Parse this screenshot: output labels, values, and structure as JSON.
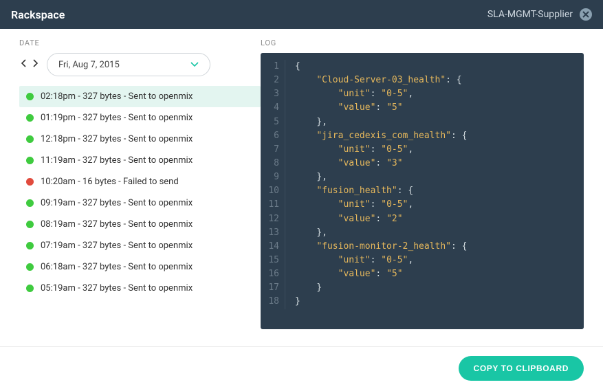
{
  "header": {
    "title": "Rackspace",
    "context": "SLA-MGMT-Supplier"
  },
  "labels": {
    "date": "DATE",
    "log": "LOG"
  },
  "date_nav": {
    "selected_date": "Fri, Aug 7, 2015"
  },
  "log_items": [
    {
      "status": "ok",
      "time": "02:18pm",
      "bytes": "327 bytes",
      "result": "Sent to openmix",
      "selected": true
    },
    {
      "status": "ok",
      "time": "01:19pm",
      "bytes": "327 bytes",
      "result": "Sent to openmix",
      "selected": false
    },
    {
      "status": "ok",
      "time": "12:18pm",
      "bytes": "327 bytes",
      "result": "Sent to openmix",
      "selected": false
    },
    {
      "status": "ok",
      "time": "11:19am",
      "bytes": "327 bytes",
      "result": "Sent to openmix",
      "selected": false
    },
    {
      "status": "fail",
      "time": "10:20am",
      "bytes": "16 bytes",
      "result": "Failed to send",
      "selected": false
    },
    {
      "status": "ok",
      "time": "09:19am",
      "bytes": "327 bytes",
      "result": "Sent to openmix",
      "selected": false
    },
    {
      "status": "ok",
      "time": "08:19am",
      "bytes": "327 bytes",
      "result": "Sent to openmix",
      "selected": false
    },
    {
      "status": "ok",
      "time": "07:19am",
      "bytes": "327 bytes",
      "result": "Sent to openmix",
      "selected": false
    },
    {
      "status": "ok",
      "time": "06:18am",
      "bytes": "327 bytes",
      "result": "Sent to openmix",
      "selected": false
    },
    {
      "status": "ok",
      "time": "05:19am",
      "bytes": "327 bytes",
      "result": "Sent to openmix",
      "selected": false
    }
  ],
  "code_pane": {
    "lines": [
      {
        "n": 1,
        "tokens": [
          [
            "punc",
            "{"
          ]
        ]
      },
      {
        "n": 2,
        "tokens": [
          [
            "indent",
            "    "
          ],
          [
            "key",
            "\"Cloud-Server-03_health\""
          ],
          [
            "punc",
            ": {"
          ]
        ]
      },
      {
        "n": 3,
        "tokens": [
          [
            "indent",
            "        "
          ],
          [
            "key",
            "\"unit\""
          ],
          [
            "punc",
            ": "
          ],
          [
            "str",
            "\"0-5\""
          ],
          [
            "punc",
            ","
          ]
        ]
      },
      {
        "n": 4,
        "tokens": [
          [
            "indent",
            "        "
          ],
          [
            "key",
            "\"value\""
          ],
          [
            "punc",
            ": "
          ],
          [
            "str",
            "\"5\""
          ]
        ]
      },
      {
        "n": 5,
        "tokens": [
          [
            "indent",
            "    "
          ],
          [
            "punc",
            "},"
          ]
        ]
      },
      {
        "n": 6,
        "tokens": [
          [
            "indent",
            "    "
          ],
          [
            "key",
            "\"jira_cedexis_com_health\""
          ],
          [
            "punc",
            ": {"
          ]
        ]
      },
      {
        "n": 7,
        "tokens": [
          [
            "indent",
            "        "
          ],
          [
            "key",
            "\"unit\""
          ],
          [
            "punc",
            ": "
          ],
          [
            "str",
            "\"0-5\""
          ],
          [
            "punc",
            ","
          ]
        ]
      },
      {
        "n": 8,
        "tokens": [
          [
            "indent",
            "        "
          ],
          [
            "key",
            "\"value\""
          ],
          [
            "punc",
            ": "
          ],
          [
            "str",
            "\"3\""
          ]
        ]
      },
      {
        "n": 9,
        "tokens": [
          [
            "indent",
            "    "
          ],
          [
            "punc",
            "},"
          ]
        ]
      },
      {
        "n": 10,
        "tokens": [
          [
            "indent",
            "    "
          ],
          [
            "key",
            "\"fusion_health\""
          ],
          [
            "punc",
            ": {"
          ]
        ]
      },
      {
        "n": 11,
        "tokens": [
          [
            "indent",
            "        "
          ],
          [
            "key",
            "\"unit\""
          ],
          [
            "punc",
            ": "
          ],
          [
            "str",
            "\"0-5\""
          ],
          [
            "punc",
            ","
          ]
        ]
      },
      {
        "n": 12,
        "tokens": [
          [
            "indent",
            "        "
          ],
          [
            "key",
            "\"value\""
          ],
          [
            "punc",
            ": "
          ],
          [
            "str",
            "\"2\""
          ]
        ]
      },
      {
        "n": 13,
        "tokens": [
          [
            "indent",
            "    "
          ],
          [
            "punc",
            "},"
          ]
        ]
      },
      {
        "n": 14,
        "tokens": [
          [
            "indent",
            "    "
          ],
          [
            "key",
            "\"fusion-monitor-2_health\""
          ],
          [
            "punc",
            ": {"
          ]
        ]
      },
      {
        "n": 15,
        "tokens": [
          [
            "indent",
            "        "
          ],
          [
            "key",
            "\"unit\""
          ],
          [
            "punc",
            ": "
          ],
          [
            "str",
            "\"0-5\""
          ],
          [
            "punc",
            ","
          ]
        ]
      },
      {
        "n": 16,
        "tokens": [
          [
            "indent",
            "        "
          ],
          [
            "key",
            "\"value\""
          ],
          [
            "punc",
            ": "
          ],
          [
            "str",
            "\"5\""
          ]
        ]
      },
      {
        "n": 17,
        "tokens": [
          [
            "indent",
            "    "
          ],
          [
            "punc",
            "}"
          ]
        ]
      },
      {
        "n": 18,
        "tokens": [
          [
            "punc",
            "}"
          ]
        ]
      }
    ]
  },
  "footer": {
    "copy_label": "COPY TO CLIPBOARD"
  }
}
